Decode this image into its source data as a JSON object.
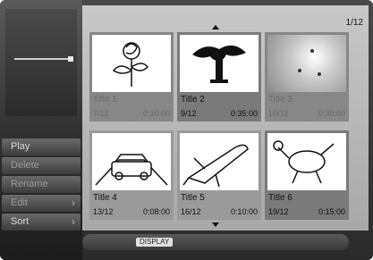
{
  "page_indicator": "1/12",
  "menu": {
    "items": [
      {
        "label": "Play",
        "has_submenu": false
      },
      {
        "label": "Delete",
        "has_submenu": false
      },
      {
        "label": "Rename",
        "has_submenu": false
      },
      {
        "label": "Edit",
        "has_submenu": true
      },
      {
        "label": "Sort",
        "has_submenu": true
      }
    ]
  },
  "tiles": [
    {
      "title": "Title 1",
      "index": "7/12",
      "duration": "0:10:00",
      "image": "rose-icon"
    },
    {
      "title": "Title 2",
      "index": "9/12",
      "duration": "0:35:00",
      "image": "tree-icon"
    },
    {
      "title": "Title 3",
      "index": "10/12",
      "duration": "0:30:00",
      "image": "foliage-icon"
    },
    {
      "title": "Title 4",
      "index": "13/12",
      "duration": "0:08:00",
      "image": "car-icon"
    },
    {
      "title": "Title 5",
      "index": "16/12",
      "duration": "0:10:00",
      "image": "shuttle-icon"
    },
    {
      "title": "Title 6",
      "index": "19/12",
      "duration": "0:15:00",
      "image": "dog-icon"
    }
  ],
  "bottom_bar": {
    "display_label": "DISPLAY"
  }
}
